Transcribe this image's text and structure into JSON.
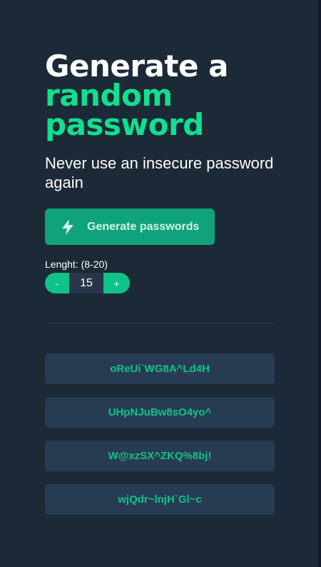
{
  "header": {
    "title_line1": "Generate a",
    "title_line2": "random",
    "title_line3": "password",
    "subtitle": "Never use an insecure password again"
  },
  "generate_button": {
    "label": "Generate passwords",
    "icon": "lightning-bolt-icon"
  },
  "length": {
    "label": "Lenght: (8-20)",
    "decrement_label": "-",
    "value": "15",
    "increment_label": "+"
  },
  "passwords": [
    "oReUi`WG8A^Ld4H",
    "UHpNJuBw8sO4yo^",
    "W@xzSX^ZKQ%8bj!",
    "wjQdr~lnjH`Gl~c"
  ],
  "colors": {
    "background": "#1c2937",
    "accent": "#10e08f",
    "button": "#10a37a",
    "password_card": "#273c52"
  }
}
